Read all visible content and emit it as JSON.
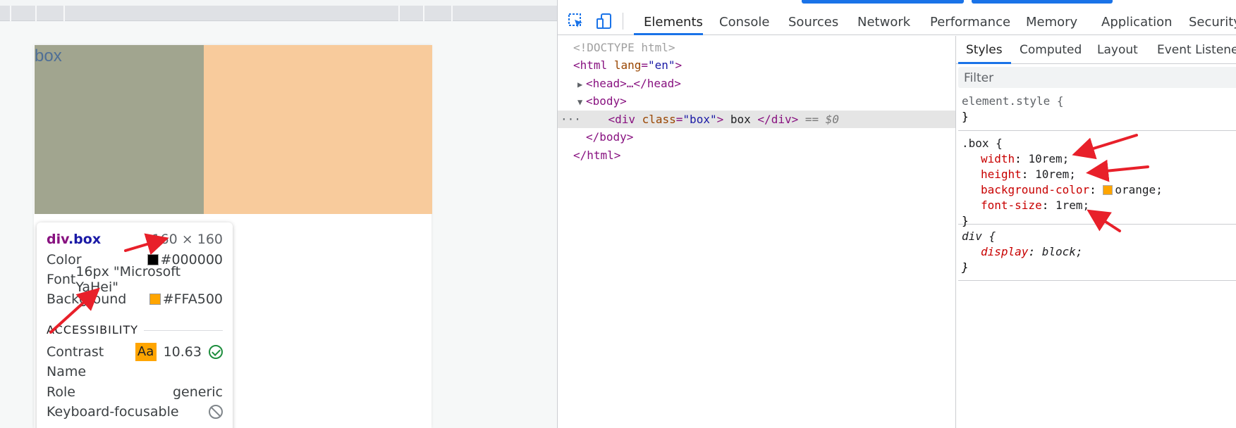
{
  "page": {
    "box_text": "box"
  },
  "tooltip": {
    "title_tag": "div",
    "title_class": ".box",
    "dimensions": "160 × 160",
    "rows": [
      {
        "label": "Color",
        "value": "#000000",
        "swatch": "#000000"
      },
      {
        "label": "Font",
        "value": "16px \"Microsoft YaHei\""
      },
      {
        "label": "Background",
        "value": "#FFA500",
        "swatch": "#FFA500"
      }
    ],
    "accessibility_heading": "ACCESSIBILITY",
    "contrast": {
      "label": "Contrast",
      "badge": "Aa",
      "value": "10.63"
    },
    "name_label": "Name",
    "role": {
      "label": "Role",
      "value": "generic"
    },
    "keyboard_focusable_label": "Keyboard-focusable"
  },
  "devtools": {
    "tabs": [
      "Elements",
      "Console",
      "Sources",
      "Network",
      "Performance",
      "Memory",
      "Application",
      "Security"
    ],
    "active_tab": "Elements",
    "dom": {
      "doctype": "<!DOCTYPE html>",
      "html_open_tag": "<html",
      "html_attr_name": "lang",
      "html_attr_value": "\"en\"",
      "head": "<head>…</head>",
      "body_open": "<body>",
      "div_open": "<div",
      "div_attr_name": "class",
      "div_attr_value": "\"box\"",
      "div_text": "box",
      "div_close": "</div>",
      "selected_marker": "== $0",
      "ellipsis": "···",
      "body_close": "</body>",
      "html_close": "</html>"
    },
    "styles": {
      "sub_tabs": [
        "Styles",
        "Computed",
        "Layout",
        "Event Listeners"
      ],
      "active_sub_tab": "Styles",
      "filter_placeholder": "Filter",
      "element_style_selector": "element.style {",
      "close_brace": "}",
      "box_selector": ".box {",
      "box_declarations": [
        {
          "prop": "width",
          "value": "10rem;"
        },
        {
          "prop": "height",
          "value": "10rem;"
        },
        {
          "prop": "background-color",
          "value": "orange;"
        },
        {
          "prop": "font-size",
          "value": "1rem;"
        }
      ],
      "div_selector": "div {",
      "div_declaration": {
        "prop": "display",
        "value": "block;"
      }
    }
  },
  "colors": {
    "accent": "#1a73e8",
    "annotation_arrow": "#e8202a",
    "box_content": "#a1a58f",
    "box_padding": "#f8cb9c"
  }
}
